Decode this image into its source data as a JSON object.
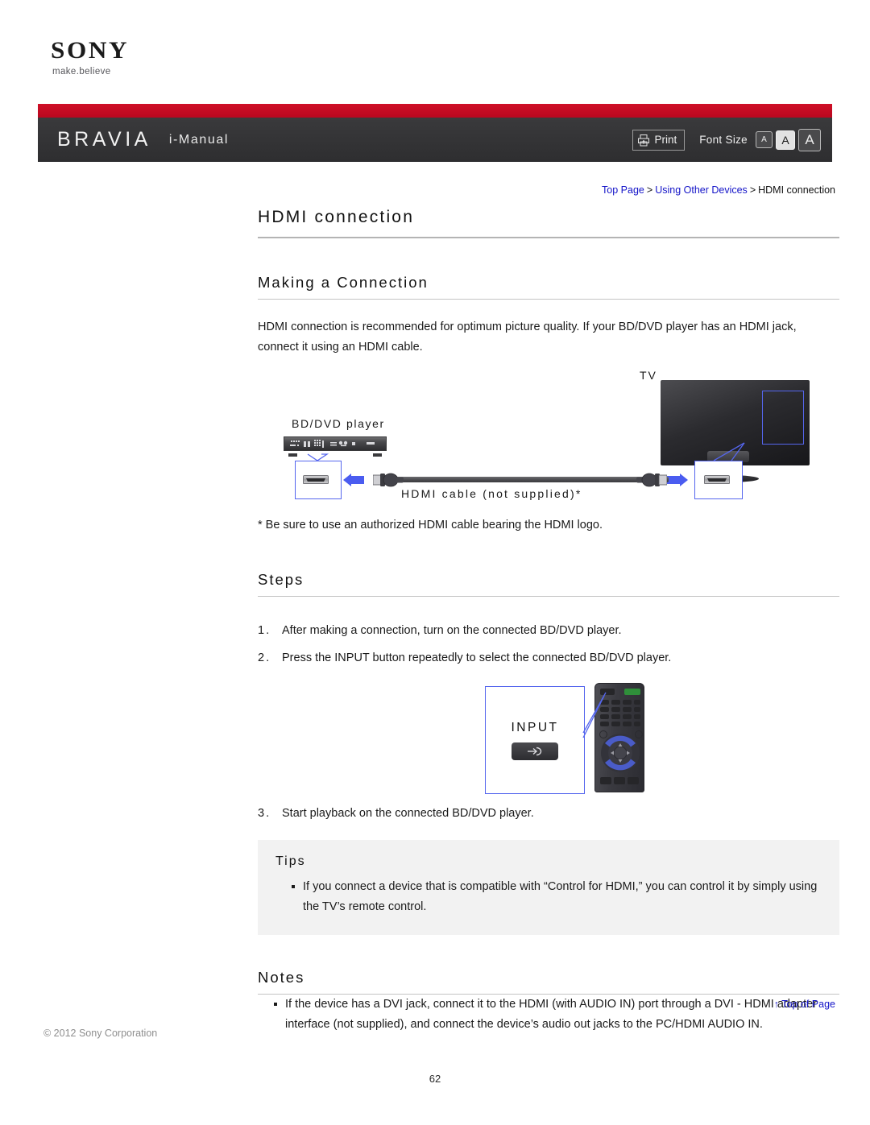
{
  "brand": {
    "logo_text": "SONY",
    "tagline": "make.believe",
    "product": "BRAVIA",
    "manual": "i-Manual"
  },
  "toolbar": {
    "print_label": "Print",
    "font_size_label": "Font Size",
    "font_size_options": [
      "A",
      "A",
      "A"
    ],
    "font_size_selected_index": 1
  },
  "breadcrumb": {
    "items": [
      "Top Page",
      "Using Other Devices",
      "HDMI connection"
    ],
    "separator": ">"
  },
  "page": {
    "title": "HDMI connection",
    "section_connection": "Making a Connection",
    "intro": "HDMI connection is recommended for optimum picture quality. If your BD/DVD player has an HDMI jack, connect it using an HDMI cable.",
    "footnote": "* Be sure to use an authorized HDMI cable bearing the HDMI logo.",
    "section_steps": "Steps",
    "section_notes": "Notes"
  },
  "diagram": {
    "label_tv": "TV",
    "label_bd_player": "BD/DVD player",
    "label_cable": "HDMI cable (not supplied)*"
  },
  "steps": [
    {
      "num": "1.",
      "text": "After making a connection, turn on the connected BD/DVD player."
    },
    {
      "num": "2.",
      "text": "Press the INPUT button repeatedly to select the connected BD/DVD player."
    },
    {
      "num": "3.",
      "text": "Start playback on the connected BD/DVD player."
    }
  ],
  "remote": {
    "input_label": "INPUT"
  },
  "tips": {
    "title": "Tips",
    "items": [
      "If you connect a device that is compatible with “Control for HDMI,” you can control it by simply using the TV’s remote control."
    ]
  },
  "notes": {
    "items": [
      "If the device has a DVI jack, connect it to the HDMI (with AUDIO IN) port through a DVI - HDMI adapter interface (not supplied), and connect the device’s audio out jacks to the PC/HDMI AUDIO IN."
    ]
  },
  "footer": {
    "top_of_page": "↑ Top of Page",
    "copyright": "© 2012 Sony Corporation",
    "page_number": "62"
  },
  "colors": {
    "accent_red": "#c8102e",
    "header_dark": "#333335",
    "link_blue": "#1414c8",
    "callout_blue": "#5566ee"
  }
}
